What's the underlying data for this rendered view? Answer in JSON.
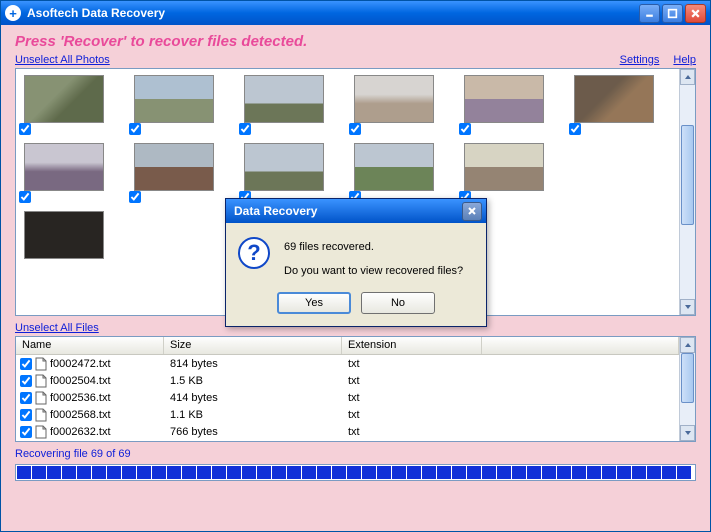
{
  "window": {
    "title": "Asoftech Data Recovery"
  },
  "instruction": "Press 'Recover' to recover files detected.",
  "links": {
    "unselect_photos": "Unselect All Photos",
    "unselect_files": "Unselect All Files",
    "settings": "Settings",
    "help": "Help"
  },
  "photos": {
    "rows": [
      [
        {
          "checked": true
        },
        {
          "checked": true
        },
        {
          "checked": true
        },
        {
          "checked": true
        },
        {
          "checked": true
        },
        {
          "checked": true
        }
      ],
      [
        {
          "checked": true
        },
        {
          "checked": true
        },
        {
          "checked": true
        },
        {
          "checked": true
        },
        {
          "checked": true
        }
      ],
      [
        {
          "checked": false
        }
      ]
    ]
  },
  "files": {
    "headers": {
      "name": "Name",
      "size": "Size",
      "ext": "Extension"
    },
    "rows": [
      {
        "name": "f0002472.txt",
        "size": "814 bytes",
        "ext": "txt",
        "checked": true
      },
      {
        "name": "f0002504.txt",
        "size": "1.5 KB",
        "ext": "txt",
        "checked": true
      },
      {
        "name": "f0002536.txt",
        "size": "414 bytes",
        "ext": "txt",
        "checked": true
      },
      {
        "name": "f0002568.txt",
        "size": "1.1 KB",
        "ext": "txt",
        "checked": true
      },
      {
        "name": "f0002632.txt",
        "size": "766 bytes",
        "ext": "txt",
        "checked": true
      }
    ]
  },
  "status": "Recovering file 69 of 69",
  "progress": {
    "segments": 45
  },
  "dialog": {
    "title": "Data Recovery",
    "line1": "69 files recovered.",
    "line2": "Do you want to view recovered files?",
    "yes": "Yes",
    "no": "No"
  }
}
